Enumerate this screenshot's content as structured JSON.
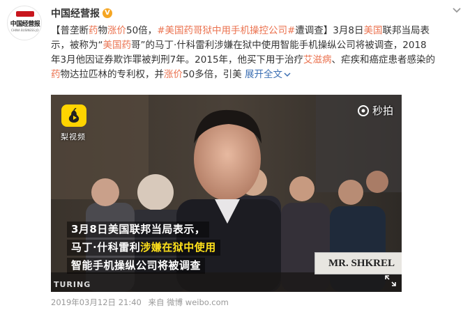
{
  "account": {
    "avatar_badge": "人民网",
    "avatar_text": "中国经营报",
    "avatar_subtext": "CHINA BUSINESS JOURNAL",
    "name": "中国经营报",
    "verified_icon": "verified-v-icon",
    "menu_icon": "chevron-down-icon"
  },
  "post": {
    "seg1": "【普垄断",
    "seg2": "药",
    "seg3": "物",
    "seg4": "涨价",
    "seg5": "50倍，",
    "topic": "#美国药哥狱中用手机操控公司#",
    "seg6": "遭调查】3月8日",
    "seg7": "美国",
    "seg8": "联邦当局表示，被称为“",
    "seg9": "美国药",
    "seg10": "哥”的马丁·什科雷利涉嫌在狱中使用智能手机操纵公司将被调查，2018年3月他因证券欺诈罪被判刑7年。2015年，他买下用于治疗",
    "seg11": "艾滋病",
    "seg12": "、疟疾和癌症患者感染的",
    "seg13": "药",
    "seg14": "物达拉匹林的专利权，并",
    "seg15": "涨价",
    "seg16": "50多倍，引美",
    "more": "展开全文",
    "more_icon": "chevron-down-small-icon"
  },
  "video": {
    "logo_text": "梨视频",
    "watermark": "秒拍",
    "caption_line1": "3月8日美国联邦当局表示，",
    "caption_line2_white": "马丁·什科雷利",
    "caption_line2_yellow": "涉嫌在狱中使用",
    "caption_line3": "智能手机操纵公司将被调查",
    "nameplate": "MR. SHKREL",
    "bottom_fragment": "TURING",
    "expand_icon": "expand-icon"
  },
  "meta": {
    "datetime": "2019年03月12日 21:40",
    "source": "来自 微博 weibo.com"
  },
  "colors": {
    "highlight": "#eb7350",
    "link": "#3c6fb3",
    "caption_yellow": "#ffe11a",
    "verified": "#f5a623"
  }
}
